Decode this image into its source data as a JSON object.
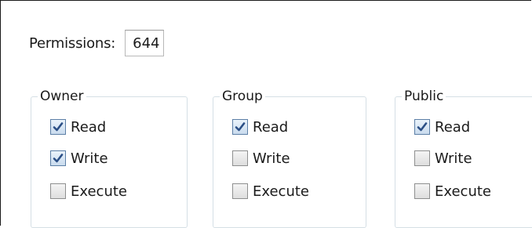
{
  "permissions": {
    "label": "Permissions:",
    "value": "644"
  },
  "groups": [
    {
      "title": "Owner",
      "options": [
        {
          "label": "Read",
          "checked": true
        },
        {
          "label": "Write",
          "checked": true
        },
        {
          "label": "Execute",
          "checked": false
        }
      ]
    },
    {
      "title": "Group",
      "options": [
        {
          "label": "Read",
          "checked": true
        },
        {
          "label": "Write",
          "checked": false
        },
        {
          "label": "Execute",
          "checked": false
        }
      ]
    },
    {
      "title": "Public",
      "options": [
        {
          "label": "Read",
          "checked": true
        },
        {
          "label": "Write",
          "checked": false
        },
        {
          "label": "Execute",
          "checked": false
        }
      ]
    }
  ],
  "colors": {
    "checkmark": "#2b4f86",
    "groupbox_border": "#d5dfe5"
  }
}
